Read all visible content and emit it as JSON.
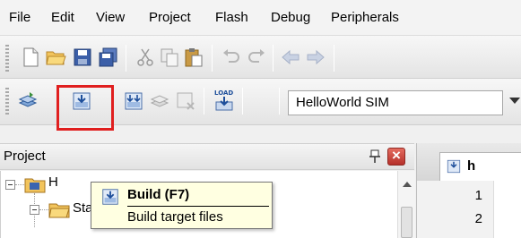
{
  "menu": [
    "File",
    "Edit",
    "View",
    "Project",
    "Flash",
    "Debug",
    "Peripherals"
  ],
  "toolbar1": {
    "icons": [
      "new-file-icon",
      "open-folder-icon",
      "save-icon",
      "save-all-icon",
      "cut-icon",
      "copy-icon",
      "paste-icon",
      "undo-icon",
      "redo-icon",
      "navigate-back-icon",
      "navigate-forward-icon"
    ]
  },
  "toolbar2": {
    "icons": [
      "translate-icon",
      "build-icon",
      "rebuild-icon",
      "batch-build-icon",
      "stop-build-icon",
      "load-icon"
    ],
    "load_icon_text": "LOAD",
    "target_value": "HelloWorld SIM"
  },
  "highlight_color": "#e01f1f",
  "project_panel": {
    "title": "Project",
    "pin_icon": "pin-icon",
    "close_icon": "close-icon",
    "tree": [
      {
        "label": "H",
        "icon": "project-folder-icon",
        "expanded": true
      },
      {
        "label": "Startup Code",
        "icon": "folder-icon",
        "expanded": true
      }
    ]
  },
  "tooltip": {
    "title": "Build (F7)",
    "description": "Build target files"
  },
  "editor": {
    "tab_label": "h",
    "line_numbers": [
      "1",
      "2"
    ]
  }
}
